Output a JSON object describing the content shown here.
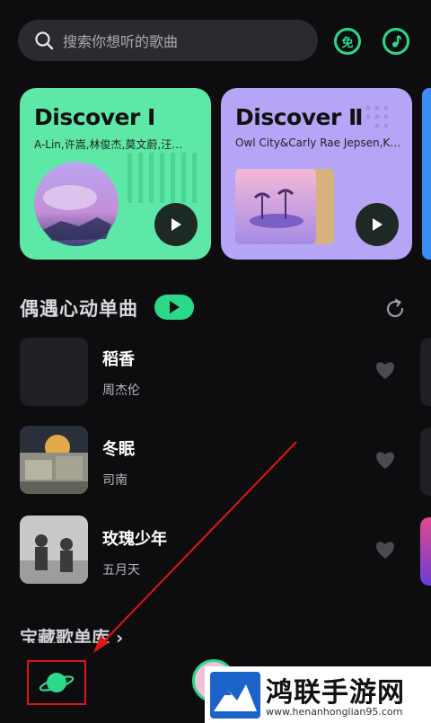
{
  "search": {
    "placeholder": "搜索你想听的歌曲"
  },
  "header": {
    "vip_label": "免"
  },
  "cards": [
    {
      "title": "Discover Ⅰ",
      "artists": "A-Lin,许嵩,林俊杰,莫文蔚,汪…"
    },
    {
      "title": "Discover Ⅱ",
      "artists": "Owl City&Carly Rae Jepsen,K…"
    }
  ],
  "section": {
    "title": "偶遇心动单曲"
  },
  "songs": [
    {
      "title": "稻香",
      "artist": "周杰伦"
    },
    {
      "title": "冬眠",
      "artist": "司南"
    },
    {
      "title": "玫瑰少年",
      "artist": "五月天"
    }
  ],
  "next_section": {
    "title": "宝藏歌单库"
  },
  "watermark": {
    "brand": "鸿联手游网",
    "url": "www.henanhonglian95.com"
  },
  "colors": {
    "accent": "#2bd98a",
    "card1": "#5ee8a8",
    "card2": "#b6a4f7",
    "annotation": "#e01515"
  }
}
